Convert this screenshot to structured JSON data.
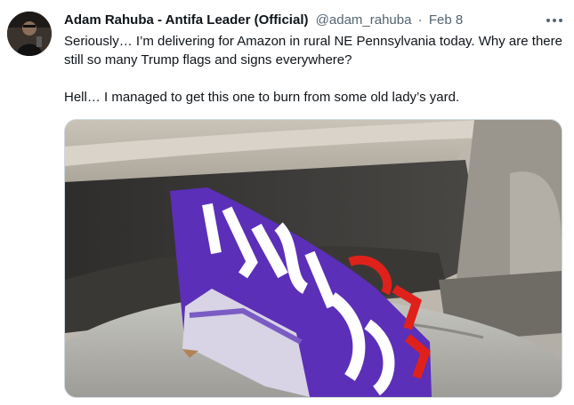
{
  "tweet": {
    "author_name": "Adam Rahuba - Antifa Leader (Official)",
    "handle": "@adam_rahuba",
    "separator": "·",
    "date": "Feb 8",
    "text_line1": "Seriously… I’m delivering for Amazon in rural NE Pennsylvania today. Why are there still so many Trump flags and signs everywhere?",
    "text_line2": "Hell… I managed to get this one to burn from some old lady’s yard.",
    "more_icon": "more-horizontal-icon",
    "media_description_icon": "photo"
  },
  "colors": {
    "text": "#0f1419",
    "secondary": "#536471",
    "border": "#cfd9de",
    "flag_purple": "#5b2fb8",
    "flag_red": "#e0211b"
  }
}
